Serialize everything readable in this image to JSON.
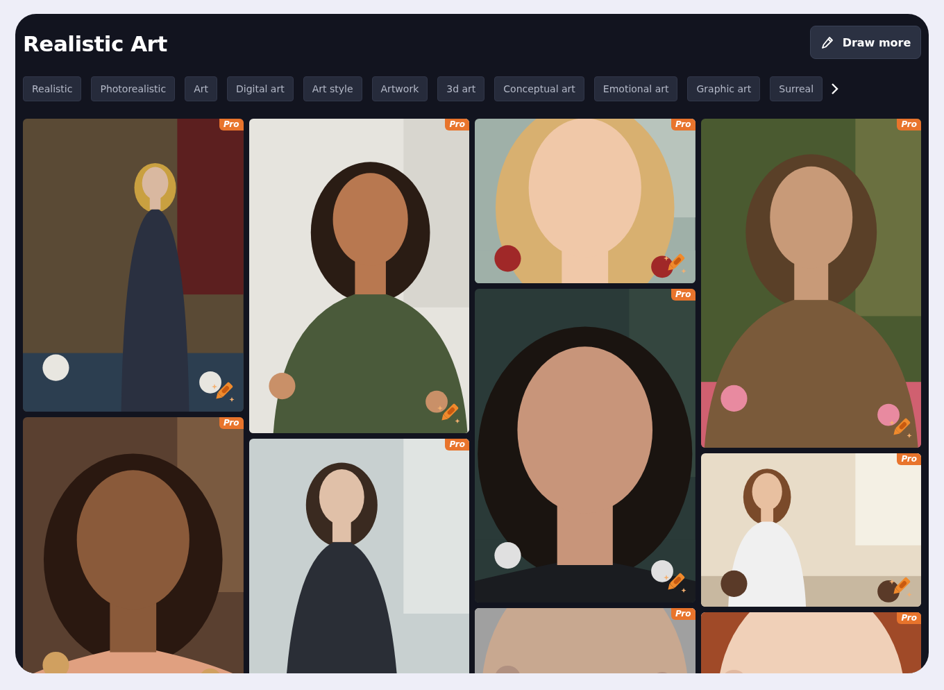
{
  "header": {
    "title": "Realistic Art",
    "button": "Draw more"
  },
  "tags": [
    "Realistic",
    "Photorealistic",
    "Art",
    "Digital art",
    "Art style",
    "Artwork",
    "3d art",
    "Conceptual art",
    "Emotional art",
    "Graphic art",
    "Surreal"
  ],
  "gallery": {
    "columns": [
      {
        "tiles": [
          {
            "kind": "picture",
            "badge": "Pro"
          },
          {
            "kind": "picture",
            "badge": "Pro"
          }
        ]
      },
      {
        "tiles": [
          {
            "kind": "picture",
            "badge": "Pro"
          },
          {
            "kind": "picture",
            "badge": "Pro"
          }
        ]
      },
      {
        "tiles": [
          {
            "kind": "picture",
            "badge": "Pro"
          },
          {
            "kind": "picture",
            "badge": "Pro"
          },
          {
            "kind": "picture",
            "badge": "Pro"
          }
        ]
      },
      {
        "tiles": [
          {
            "kind": "picture",
            "badge": "Pro"
          },
          {
            "kind": "picture",
            "badge": "Pro"
          },
          {
            "kind": "picture",
            "badge": "Pro"
          }
        ]
      }
    ]
  }
}
